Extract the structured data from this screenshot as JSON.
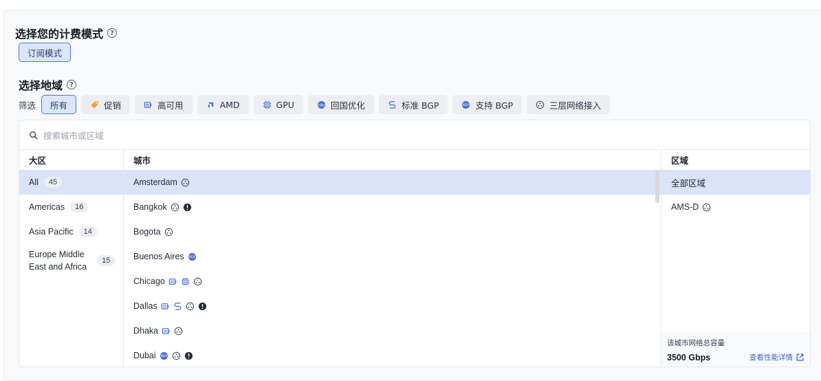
{
  "billing": {
    "title": "选择您的计费模式",
    "mode_label": "订阅模式"
  },
  "region": {
    "title": "选择地域"
  },
  "filters": {
    "label": "筛选",
    "chips": [
      {
        "label": "所有",
        "icon": "",
        "active": true
      },
      {
        "label": "促销",
        "icon": "tag-icon"
      },
      {
        "label": "高可用",
        "icon": "server-icon"
      },
      {
        "label": "AMD",
        "icon": "amd-icon"
      },
      {
        "label": "GPU",
        "icon": "chip-icon"
      },
      {
        "label": "回国优化",
        "icon": "china-optimized-icon"
      },
      {
        "label": "标准 BGP",
        "icon": "route-icon"
      },
      {
        "label": "支持 BGP",
        "icon": "bgp-icon"
      },
      {
        "label": "三层网络接入",
        "icon": "network-icon"
      }
    ]
  },
  "search": {
    "placeholder": "搜索城市或区域"
  },
  "columns": {
    "region": "大区",
    "city": "城市",
    "zone": "区域"
  },
  "regions": [
    {
      "name": "All",
      "count": "45"
    },
    {
      "name": "Americas",
      "count": "16"
    },
    {
      "name": "Asia Pacific",
      "count": "14"
    },
    {
      "name": "Europe Middle East and Africa",
      "line1": "Europe Middle",
      "line2": "East and Africa",
      "count": "15"
    }
  ],
  "cities": [
    {
      "name": "Amsterdam",
      "icons": [
        "network-icon"
      ]
    },
    {
      "name": "Bangkok",
      "icons": [
        "network-icon",
        "alert-icon"
      ]
    },
    {
      "name": "Bogota",
      "icons": [
        "network-icon"
      ]
    },
    {
      "name": "Buenos Aires",
      "icons": [
        "bgp-icon"
      ]
    },
    {
      "name": "Chicago",
      "icons": [
        "server-icon",
        "chip-icon",
        "network-icon"
      ]
    },
    {
      "name": "Dallas",
      "icons": [
        "server-icon",
        "route-icon",
        "network-icon",
        "alert-icon"
      ]
    },
    {
      "name": "Dhaka",
      "icons": [
        "server-icon",
        "network-icon"
      ]
    },
    {
      "name": "Dubai",
      "icons": [
        "bgp-icon",
        "network-icon",
        "alert-icon"
      ]
    }
  ],
  "zones": [
    {
      "name": "全部区域",
      "icons": []
    },
    {
      "name": "AMS-D",
      "icons": [
        "network-icon"
      ]
    }
  ],
  "capacity": {
    "label": "该城市网络总容量",
    "value": "3500 Gbps",
    "link": "查看性能详情"
  },
  "colors": {
    "accent": "#4f75d6",
    "selected_row": "#d9e4f8",
    "link": "#3c6ad0",
    "promo": "#f0a03c"
  }
}
